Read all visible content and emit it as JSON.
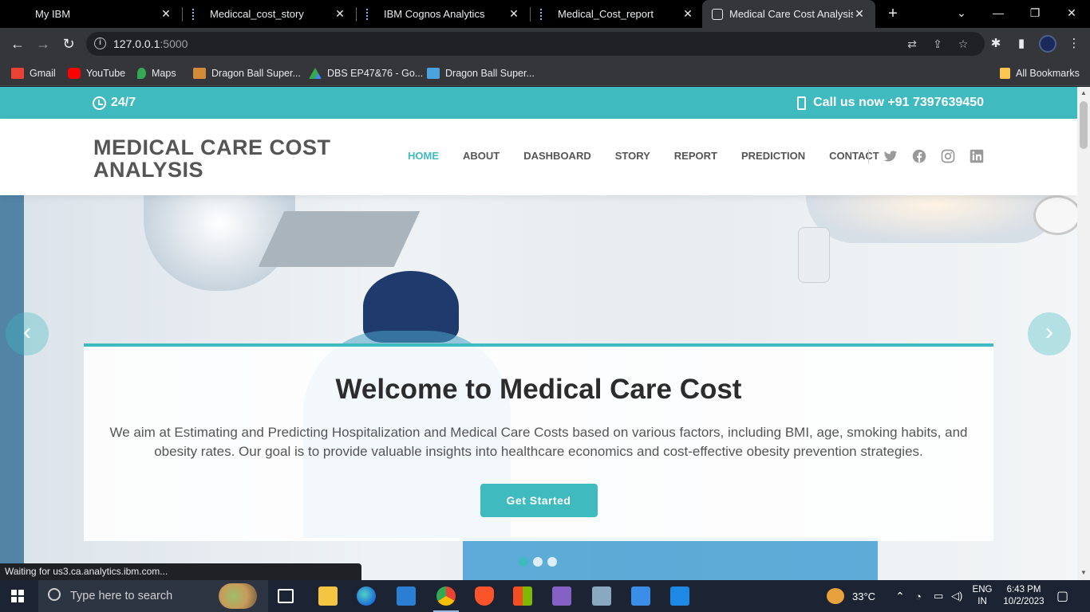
{
  "browser": {
    "tabs": [
      {
        "title": "My IBM",
        "active": false
      },
      {
        "title": "Mediccal_cost_story",
        "active": false
      },
      {
        "title": "IBM Cognos Analytics",
        "active": false
      },
      {
        "title": "Medical_Cost_report",
        "active": false
      },
      {
        "title": "Medical Care Cost Analysis",
        "active": true
      }
    ],
    "url_host": "127.0.0.1",
    "url_port": ":5000",
    "bookmarks": [
      {
        "label": "Gmail",
        "icon": "gmail-icon",
        "color": "#ea4335"
      },
      {
        "label": "YouTube",
        "icon": "youtube-icon",
        "color": "#ff0000"
      },
      {
        "label": "Maps",
        "icon": "maps-icon",
        "color": "#34a853"
      },
      {
        "label": "Dragon Ball Super...",
        "icon": "dragonball-icon",
        "color": "#d38b3a"
      },
      {
        "label": "DBS EP47&76 - Go...",
        "icon": "drive-icon",
        "color": "#fbbc04"
      },
      {
        "label": "Dragon Ball Super...",
        "icon": "site-icon",
        "color": "#4aa3df"
      }
    ],
    "all_bookmarks": "All Bookmarks",
    "status_text": "Waiting for us3.ca.analytics.ibm.com..."
  },
  "site": {
    "topbar": {
      "hours": "24/7",
      "call": "Call us now +91 7397639450"
    },
    "logo_line1": "MEDICAL CARE COST",
    "logo_line2": "ANALYSIS",
    "nav": [
      "HOME",
      "ABOUT",
      "DASHBOARD",
      "STORY",
      "REPORT",
      "PREDICTION",
      "CONTACT"
    ],
    "social": [
      "twitter-icon",
      "facebook-icon",
      "instagram-icon",
      "linkedin-icon"
    ],
    "hero": {
      "title": "Welcome to Medical Care Cost",
      "text": "We aim at Estimating and Predicting Hospitalization and Medical Care Costs based on various factors, including BMI, age, smoking habits, and obesity rates. Our goal is to provide valuable insights into healthcare economics and cost-effective obesity prevention strategies.",
      "button": "Get Started",
      "slides": 3,
      "active_slide": 1
    }
  },
  "taskbar": {
    "search_placeholder": "Type here to search",
    "weather": "33°C",
    "lang_top": "ENG",
    "lang_bottom": "IN",
    "time": "6:43 PM",
    "date": "10/2/2023"
  },
  "colors": {
    "accent": "#3fbbc0"
  }
}
